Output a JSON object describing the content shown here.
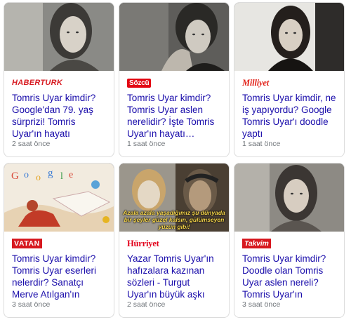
{
  "cards": [
    {
      "source": "HABERTURK",
      "headline": "Tomris Uyar kimdir? Google'dan 79. yaş sürprizi! Tomris Uyar'ın hayatı",
      "time": "2 saat önce"
    },
    {
      "source": "Sözcü",
      "headline": "Tomris Uyar kimdir? Tomris Uyar aslen nerelidir? İşte Tomris Uyar'ın hayatı…",
      "time": "1 saat önce"
    },
    {
      "source": "Milliyet",
      "headline": "Tomris Uyar kimdir, ne iş yapıyordu? Google Tomris Uyar'ı doodle yaptı",
      "time": "1 saat önce"
    },
    {
      "source": "VATAN",
      "headline": "Tomris Uyar kimdir? Tomris Uyar eserleri nelerdir? Sanatçı Merve Atılgan'ın illüstrasyonu…",
      "time": "3 saat önce"
    },
    {
      "source": "Hürriyet",
      "headline": "Yazar Tomris Uyar'ın hafızalara kazınan sözleri - Turgut Uyar'ın büyük aşkı Tomris…",
      "time": "2 saat önce",
      "image_caption": "Azala azala yaşadığımız şu dünyada bir şeyler güzel kalsın, gülümseyen yüzün gibi!"
    },
    {
      "source": "Takvim",
      "headline": "Tomris Uyar kimdir? Doodle olan Tomris Uyar aslen nereli? Tomris Uyar'ın kitapları, eserl…",
      "time": "3 saat önce"
    }
  ],
  "colors": {
    "link": "#1a0dab",
    "meta": "#70757a",
    "border": "#dcdcdc"
  }
}
